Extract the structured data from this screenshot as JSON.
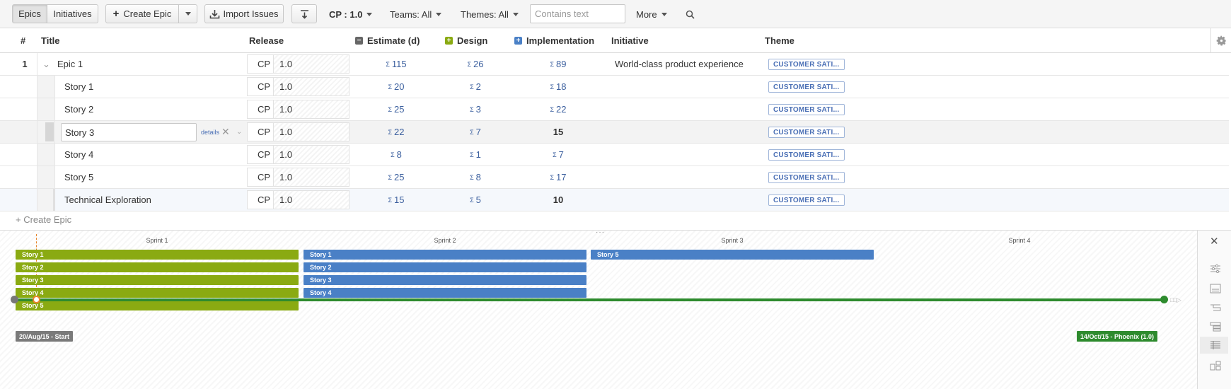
{
  "toolbar": {
    "tab_epics": "Epics",
    "tab_initiatives": "Initiatives",
    "create_epic": "Create Epic",
    "import_issues": "Import Issues",
    "release_filter": "CP : 1.0",
    "teams_filter": "Teams: All",
    "themes_filter": "Themes: All",
    "search_placeholder": "Contains text",
    "more": "More"
  },
  "columns": {
    "num": "#",
    "title": "Title",
    "release": "Release",
    "estimate": "Estimate (d)",
    "design": "Design",
    "implementation": "Implementation",
    "initiative": "Initiative",
    "theme": "Theme"
  },
  "epic": {
    "num": "1",
    "title": "Epic 1",
    "release_project": "CP",
    "release_version": "1.0",
    "sigma": "Σ",
    "estimate": "115",
    "design": "26",
    "implementation": "89",
    "initiative": "World-class product experience",
    "theme": "CUSTOMER SATI..."
  },
  "stories": [
    {
      "title": "Story 1",
      "release_project": "CP",
      "release_version": "1.0",
      "estimate": "20",
      "design": "2",
      "implementation": "18",
      "impl_sigma": true,
      "theme": "CUSTOMER SATI..."
    },
    {
      "title": "Story 2",
      "release_project": "CP",
      "release_version": "1.0",
      "estimate": "25",
      "design": "3",
      "implementation": "22",
      "impl_sigma": true,
      "theme": "CUSTOMER SATI..."
    },
    {
      "title": "Story 3",
      "release_project": "CP",
      "release_version": "1.0",
      "estimate": "22",
      "design": "7",
      "implementation": "15",
      "impl_sigma": false,
      "theme": "CUSTOMER SATI...",
      "details_link": "details"
    },
    {
      "title": "Story 4",
      "release_project": "CP",
      "release_version": "1.0",
      "estimate": "8",
      "design": "1",
      "implementation": "7",
      "impl_sigma": true,
      "theme": "CUSTOMER SATI..."
    },
    {
      "title": "Story 5",
      "release_project": "CP",
      "release_version": "1.0",
      "estimate": "25",
      "design": "8",
      "implementation": "17",
      "impl_sigma": true,
      "theme": "CUSTOMER SATI..."
    },
    {
      "title": "Technical Exploration",
      "release_project": "CP",
      "release_version": "1.0",
      "estimate": "15",
      "design": "5",
      "implementation": "10",
      "impl_sigma": false,
      "theme": "CUSTOMER SATI..."
    }
  ],
  "create_epic_link": "+ Create Epic",
  "timeline": {
    "sprints": [
      "Sprint 1",
      "Sprint 2",
      "Sprint 3",
      "Sprint 4"
    ],
    "sprint1_bars": [
      "Story 1",
      "Story 2",
      "Story 3",
      "Story 4",
      "Story 5"
    ],
    "sprint2_bars": [
      "Story 1",
      "Story 2",
      "Story 3",
      "Story 4"
    ],
    "sprint3_bars": [
      "Story 5"
    ],
    "start_label": "20/Aug/15 - Start",
    "end_label": "14/Oct/15 - Phoenix (1.0)",
    "colors": {
      "design": "#8aaa12",
      "implementation": "#4a80c6",
      "release_line": "#2e8b2e",
      "today_marker": "#e8852c"
    }
  }
}
